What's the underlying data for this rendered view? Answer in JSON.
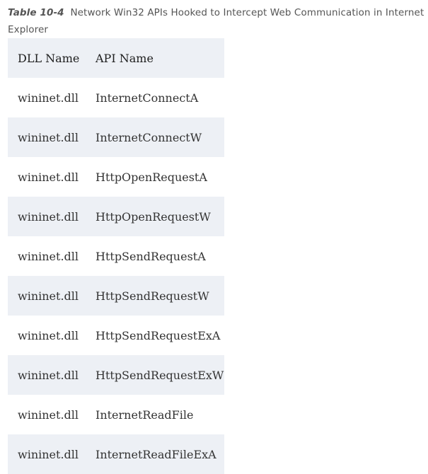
{
  "caption": {
    "label": "Table 10-4",
    "text": "Network Win32 APIs Hooked to Intercept Web Communication in Internet Explorer"
  },
  "table": {
    "headers": [
      "DLL Name",
      "API Name"
    ],
    "rows": [
      [
        "wininet.dll",
        "InternetConnectA"
      ],
      [
        "wininet.dll",
        "InternetConnectW"
      ],
      [
        "wininet.dll",
        "HttpOpenRequestA"
      ],
      [
        "wininet.dll",
        "HttpOpenRequestW"
      ],
      [
        "wininet.dll",
        "HttpSendRequestA"
      ],
      [
        "wininet.dll",
        "HttpSendRequestW"
      ],
      [
        "wininet.dll",
        "HttpSendRequestExA"
      ],
      [
        "wininet.dll",
        "HttpSendRequestExW"
      ],
      [
        "wininet.dll",
        "InternetReadFile"
      ],
      [
        "wininet.dll",
        "InternetReadFileExA"
      ]
    ]
  },
  "colors": {
    "row_shade": "#edf0f5",
    "text": "#333333",
    "caption_text": "#555555"
  }
}
